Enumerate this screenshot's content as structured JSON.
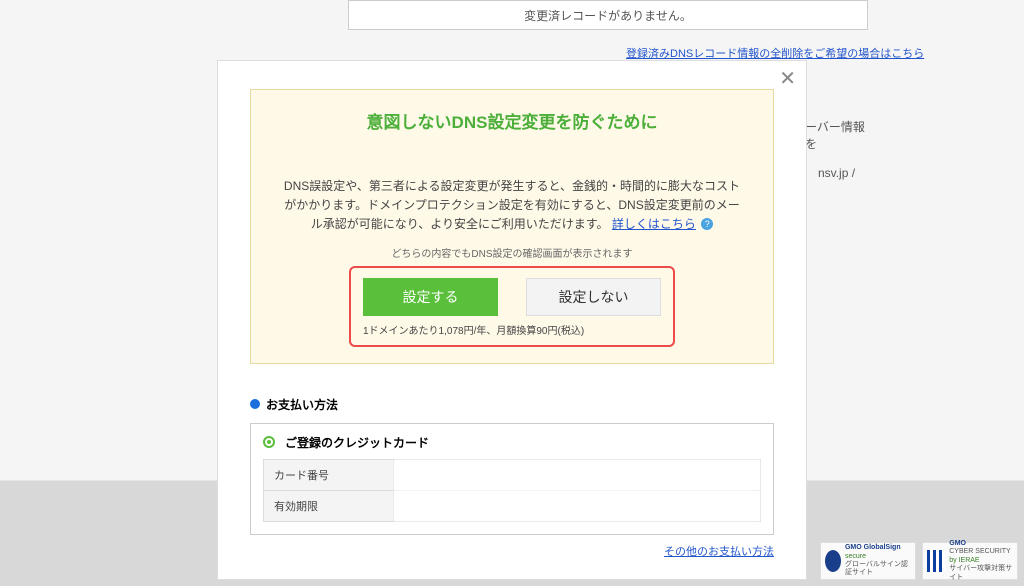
{
  "bg": {
    "no_records": "変更済レコードがありません。",
    "delete_link": "登録済みDNSレコード情報の全削除をご希望の場合はこちら",
    "server_info_frag": "ーバー情報を",
    "server_suffix": "nsv.jp /"
  },
  "modal": {
    "close_glyph": "✕",
    "title": "意図しないDNS設定変更を防ぐために",
    "subtitle_obscured": "　　　　　　　　　　　",
    "body": "DNS誤設定や、第三者による設定変更が発生すると、金銭的・時間的に膨大なコストがかかります。ドメインプロテクション設定を有効にすると、DNS設定変更前のメール承認が可能になり、より安全にご利用いただけます。",
    "body_link": "詳しくはこちら",
    "help_glyph": "?",
    "note": "どちらの内容でもDNS設定の確認画面が表示されます",
    "btn_configure": "設定する",
    "btn_skip": "設定しない",
    "price_note": "1ドメインあたり1,078円/年、月額換算90円(税込)"
  },
  "payment": {
    "heading": "お支払い方法",
    "option_label": "ご登録のクレジットカード",
    "rows": [
      {
        "k": "カード番号",
        "v": "　　　　　　　　"
      },
      {
        "k": "有効期限",
        "v": "　　　　"
      }
    ],
    "other_link": "その他のお支払い方法"
  },
  "badges": {
    "gs": {
      "brand": "GMO",
      "name": "GlobalSign",
      "sub": "secure",
      "note": "グローバルサイン認証サイト"
    },
    "ierae": {
      "brand": "GMO",
      "name": "CYBER SECURITY",
      "sub": "by IERAE",
      "note": "サイバー攻撃対策サイト"
    }
  }
}
